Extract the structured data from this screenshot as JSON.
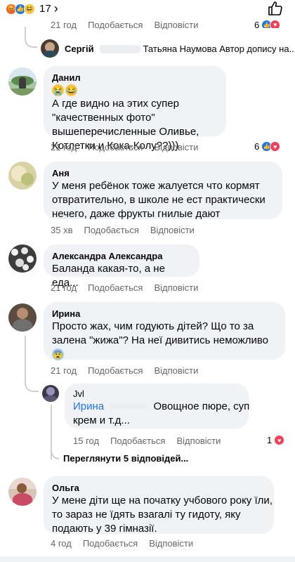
{
  "header": {
    "reaction_count": "17",
    "reaction_icons": [
      "angry-icon",
      "like-icon",
      "haha-icon"
    ],
    "chevron": "›"
  },
  "partial_actions": {
    "time": "21 год",
    "like": "Подобається",
    "reply": "Відповісти",
    "count": "6"
  },
  "serhii_reply": {
    "name": "Сергій",
    "text": "Татьяна Наумова Автор допису на..."
  },
  "comments": [
    {
      "author": "Данил",
      "emoji": [
        "sob-emoji",
        "laugh-emoji"
      ],
      "text": "А где видно на этих супер \"качественных фото\" вышеперечисленные Оливье, Котлетки и Кока-Колу??)))",
      "time": "21 год",
      "like": "Подобається",
      "reply": "Відповісти",
      "reactions": "6"
    },
    {
      "author": "Аня",
      "text": "У меня ребёнок тоже жалуется что кормят отвратительно, в школе не ест практически нечего, даже фрукты гнилые дают",
      "time": "35 хв",
      "like": "Подобається",
      "reply": "Відповісти"
    },
    {
      "author": "Александра Александра",
      "text": "Баланда какая-то, а не еда...",
      "time": "21 год",
      "like": "Подобається",
      "reply": "Відповісти"
    },
    {
      "author": "Ирина",
      "text": "Просто жах, чим годують дітей? Що то за залена \"жижа\"? На неї дивитись неможливо",
      "time": "21 год",
      "like": "Подобається",
      "reply": "Відповісти"
    }
  ],
  "jvl_reply": {
    "author": "Jvl",
    "mention": "Ирина",
    "text_line1": "Овощное пюре, суп",
    "text_line2": "крем и т.д...",
    "time": "15 год",
    "like": "Подобається",
    "reply": "Відповісти",
    "reactions": "1"
  },
  "view_more": "Переглянути 5 відповідей...",
  "olga": {
    "author": "Ольга",
    "text": "У мене діти ще на початку учбового року їли, то зараз не їдять взагалі ту гидоту, яку подають у 39 гімназії.",
    "time": "4 год",
    "like": "Подобається",
    "reply": "Відповісти"
  },
  "colors": {
    "bubble": "#f0f2f5",
    "secondary_text": "#65676b",
    "mention": "#1877f2",
    "heart": "#f33e58"
  }
}
